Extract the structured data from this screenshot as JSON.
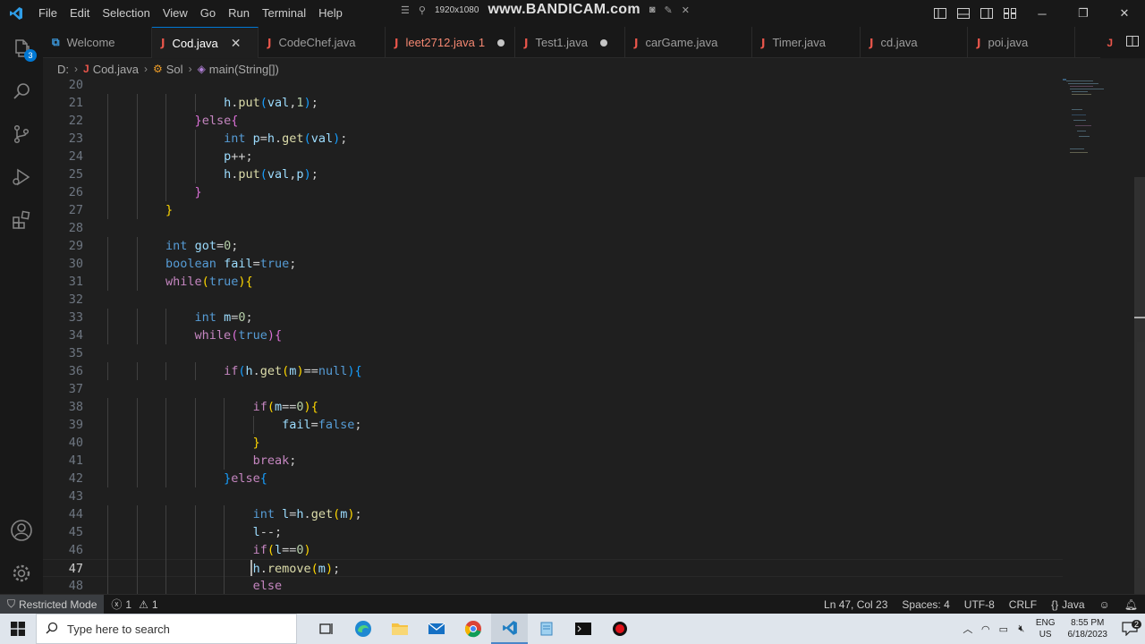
{
  "titlebar": {
    "menu": [
      "File",
      "Edit",
      "Selection",
      "View",
      "Go",
      "Run",
      "Terminal",
      "Help"
    ],
    "recorder_resolution": "1920x1080",
    "recorder_brand": "www.BANDICAM.com"
  },
  "activity": {
    "source_control_badge": "3"
  },
  "tabs": [
    {
      "label": "Welcome",
      "icon": "vscode-icon",
      "state": ""
    },
    {
      "label": "Cod.java",
      "icon": "java-icon",
      "state": "active"
    },
    {
      "label": "CodeChef.java",
      "icon": "java-icon",
      "state": ""
    },
    {
      "label": "leet2712.java",
      "icon": "java-icon",
      "state": "error",
      "meta": "1"
    },
    {
      "label": "Test1.java",
      "icon": "java-icon",
      "state": "dirty"
    },
    {
      "label": "carGame.java",
      "icon": "java-icon",
      "state": ""
    },
    {
      "label": "Timer.java",
      "icon": "java-icon",
      "state": ""
    },
    {
      "label": "cd.java",
      "icon": "java-icon",
      "state": ""
    },
    {
      "label": "poi.java",
      "icon": "java-icon",
      "state": ""
    }
  ],
  "breadcrumb": {
    "drive": "D:",
    "file": "Cod.java",
    "class": "Sol",
    "method": "main(String[])"
  },
  "editor": {
    "current_line": 47,
    "lines": [
      {
        "n": "20",
        "indent": 0,
        "tokens": []
      },
      {
        "n": "21",
        "indent": 8,
        "tokens": [
          [
            "var",
            "h"
          ],
          [
            "pl",
            "."
          ],
          [
            "fn",
            "put"
          ],
          [
            "b3",
            "("
          ],
          [
            "var",
            "val"
          ],
          [
            "pl",
            ","
          ],
          [
            "num",
            "1"
          ],
          [
            "b3",
            ")"
          ],
          [
            "pl",
            ";"
          ]
        ]
      },
      {
        "n": "22",
        "indent": 6,
        "tokens": [
          [
            "b2",
            "}"
          ],
          [
            "ctl",
            "else"
          ],
          [
            "b2",
            "{"
          ]
        ]
      },
      {
        "n": "23",
        "indent": 8,
        "tokens": [
          [
            "kw",
            "int"
          ],
          [
            "pl",
            " "
          ],
          [
            "var",
            "p"
          ],
          [
            "pl",
            "="
          ],
          [
            "var",
            "h"
          ],
          [
            "pl",
            "."
          ],
          [
            "fn",
            "get"
          ],
          [
            "b3",
            "("
          ],
          [
            "var",
            "val"
          ],
          [
            "b3",
            ")"
          ],
          [
            "pl",
            ";"
          ]
        ]
      },
      {
        "n": "24",
        "indent": 8,
        "tokens": [
          [
            "var",
            "p"
          ],
          [
            "pl",
            "++;"
          ]
        ]
      },
      {
        "n": "25",
        "indent": 8,
        "tokens": [
          [
            "var",
            "h"
          ],
          [
            "pl",
            "."
          ],
          [
            "fn",
            "put"
          ],
          [
            "b3",
            "("
          ],
          [
            "var",
            "val"
          ],
          [
            "pl",
            ","
          ],
          [
            "var",
            "p"
          ],
          [
            "b3",
            ")"
          ],
          [
            "pl",
            ";"
          ]
        ]
      },
      {
        "n": "26",
        "indent": 6,
        "tokens": [
          [
            "b2",
            "}"
          ]
        ]
      },
      {
        "n": "27",
        "indent": 4,
        "tokens": [
          [
            "b1",
            "}"
          ]
        ]
      },
      {
        "n": "28",
        "indent": 0,
        "tokens": []
      },
      {
        "n": "29",
        "indent": 4,
        "tokens": [
          [
            "kw",
            "int"
          ],
          [
            "pl",
            " "
          ],
          [
            "var",
            "got"
          ],
          [
            "pl",
            "="
          ],
          [
            "num",
            "0"
          ],
          [
            "pl",
            ";"
          ]
        ]
      },
      {
        "n": "30",
        "indent": 4,
        "tokens": [
          [
            "kw",
            "boolean"
          ],
          [
            "pl",
            " "
          ],
          [
            "var",
            "fail"
          ],
          [
            "pl",
            "="
          ],
          [
            "kw",
            "true"
          ],
          [
            "pl",
            ";"
          ]
        ]
      },
      {
        "n": "31",
        "indent": 4,
        "tokens": [
          [
            "ctl",
            "while"
          ],
          [
            "b1",
            "("
          ],
          [
            "kw",
            "true"
          ],
          [
            "b1",
            ")"
          ],
          [
            "b1",
            "{"
          ]
        ]
      },
      {
        "n": "32",
        "indent": 0,
        "tokens": []
      },
      {
        "n": "33",
        "indent": 6,
        "tokens": [
          [
            "kw",
            "int"
          ],
          [
            "pl",
            " "
          ],
          [
            "var",
            "m"
          ],
          [
            "pl",
            "="
          ],
          [
            "num",
            "0"
          ],
          [
            "pl",
            ";"
          ]
        ]
      },
      {
        "n": "34",
        "indent": 6,
        "tokens": [
          [
            "ctl",
            "while"
          ],
          [
            "b2",
            "("
          ],
          [
            "kw",
            "true"
          ],
          [
            "b2",
            ")"
          ],
          [
            "b2",
            "{"
          ]
        ]
      },
      {
        "n": "35",
        "indent": 0,
        "tokens": []
      },
      {
        "n": "36",
        "indent": 8,
        "tokens": [
          [
            "ctl",
            "if"
          ],
          [
            "b3",
            "("
          ],
          [
            "var",
            "h"
          ],
          [
            "pl",
            "."
          ],
          [
            "fn",
            "get"
          ],
          [
            "b1",
            "("
          ],
          [
            "var",
            "m"
          ],
          [
            "b1",
            ")"
          ],
          [
            "pl",
            "=="
          ],
          [
            "kw",
            "null"
          ],
          [
            "b3",
            ")"
          ],
          [
            "b3",
            "{"
          ]
        ]
      },
      {
        "n": "37",
        "indent": 0,
        "tokens": []
      },
      {
        "n": "38",
        "indent": 10,
        "tokens": [
          [
            "ctl",
            "if"
          ],
          [
            "b1",
            "("
          ],
          [
            "var",
            "m"
          ],
          [
            "pl",
            "=="
          ],
          [
            "num",
            "0"
          ],
          [
            "b1",
            ")"
          ],
          [
            "b1",
            "{"
          ]
        ]
      },
      {
        "n": "39",
        "indent": 12,
        "tokens": [
          [
            "var",
            "fail"
          ],
          [
            "pl",
            "="
          ],
          [
            "kw",
            "false"
          ],
          [
            "pl",
            ";"
          ]
        ]
      },
      {
        "n": "40",
        "indent": 10,
        "tokens": [
          [
            "b1",
            "}"
          ]
        ]
      },
      {
        "n": "41",
        "indent": 10,
        "tokens": [
          [
            "ctl",
            "break"
          ],
          [
            "pl",
            ";"
          ]
        ]
      },
      {
        "n": "42",
        "indent": 8,
        "tokens": [
          [
            "b3",
            "}"
          ],
          [
            "ctl",
            "else"
          ],
          [
            "b3",
            "{"
          ]
        ]
      },
      {
        "n": "43",
        "indent": 0,
        "tokens": []
      },
      {
        "n": "44",
        "indent": 10,
        "tokens": [
          [
            "kw",
            "int"
          ],
          [
            "pl",
            " "
          ],
          [
            "var",
            "l"
          ],
          [
            "pl",
            "="
          ],
          [
            "var",
            "h"
          ],
          [
            "pl",
            "."
          ],
          [
            "fn",
            "get"
          ],
          [
            "b1",
            "("
          ],
          [
            "var",
            "m"
          ],
          [
            "b1",
            ")"
          ],
          [
            "pl",
            ";"
          ]
        ]
      },
      {
        "n": "45",
        "indent": 10,
        "tokens": [
          [
            "var",
            "l"
          ],
          [
            "pl",
            "--;"
          ]
        ]
      },
      {
        "n": "46",
        "indent": 10,
        "tokens": [
          [
            "ctl",
            "if"
          ],
          [
            "b1",
            "("
          ],
          [
            "var",
            "l"
          ],
          [
            "pl",
            "=="
          ],
          [
            "num",
            "0"
          ],
          [
            "b1",
            ")"
          ]
        ]
      },
      {
        "n": "47",
        "indent": 10,
        "tokens": [
          [
            "var",
            "h"
          ],
          [
            "pl",
            "."
          ],
          [
            "fn",
            "remove"
          ],
          [
            "b1",
            "("
          ],
          [
            "var",
            "m"
          ],
          [
            "b1",
            ")"
          ],
          [
            "pl",
            ";"
          ]
        ]
      },
      {
        "n": "48",
        "indent": 10,
        "tokens": [
          [
            "ctl",
            "else"
          ]
        ]
      }
    ]
  },
  "status": {
    "restricted": "Restricted Mode",
    "errors": "1",
    "warnings": "1",
    "position": "Ln 47, Col 23",
    "spaces": "Spaces: 4",
    "encoding": "UTF-8",
    "eol": "CRLF",
    "language": "Java"
  },
  "taskbar": {
    "search_placeholder": "Type here to search",
    "lang_top": "ENG",
    "lang_bottom": "US",
    "time": "8:55 PM",
    "date": "6/18/2023",
    "notification_count": "2"
  }
}
